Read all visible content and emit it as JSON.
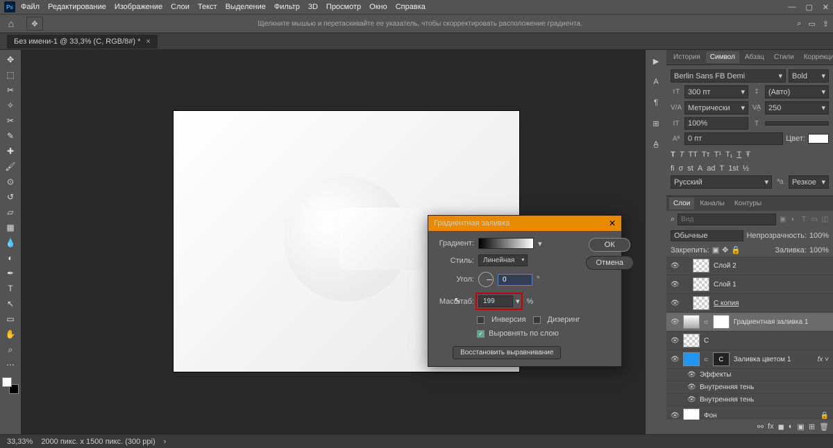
{
  "app": {
    "logo": "Ps"
  },
  "menu": [
    "Файл",
    "Редактирование",
    "Изображение",
    "Слои",
    "Текст",
    "Выделение",
    "Фильтр",
    "3D",
    "Просмотр",
    "Окно",
    "Справка"
  ],
  "optbar_hint": "Щелкните мышью и перетаскивайте ее указатель, чтобы скорректировать расположение градиента.",
  "doc_tab": "Без имени-1 @ 33,3% (C, RGB/8#) *",
  "panels_top": {
    "tabs": [
      "История",
      "Символ",
      "Абзац",
      "Стили",
      "Коррекция"
    ],
    "active": 1
  },
  "char": {
    "font": "Berlin Sans FB Demi",
    "style": "Bold",
    "size": "300 пт",
    "leading": "(Авто)",
    "kerning": "Метрически",
    "tracking": "250",
    "vscale": "100%",
    "hscale": "",
    "baseline": "0 пт",
    "color_label": "Цвет:",
    "lang": "Русский",
    "aa": "Резкое"
  },
  "layers_tabs": {
    "tabs": [
      "Слои",
      "Каналы",
      "Контуры"
    ],
    "active": 0
  },
  "layers_panel": {
    "filter_placeholder": "Вид",
    "blend": "Обычные",
    "op_label": "Непрозрачность:",
    "op": "100%",
    "lock_label": "Закрепить:",
    "fill_label": "Заливка:",
    "fill": "100%"
  },
  "layers": [
    {
      "name": "Слой 2",
      "thumb": "checker"
    },
    {
      "name": "Слой 1",
      "thumb": "checker"
    },
    {
      "name": "С копия",
      "thumb": "checker",
      "u": true
    },
    {
      "name": "Градиентная заливка 1",
      "thumb": "grad",
      "sel": true,
      "mask": true
    },
    {
      "name": "С",
      "thumb": "checker"
    },
    {
      "name": "Заливка цветом 1",
      "thumb": "blue",
      "mask": true,
      "maskC": true,
      "fx": true
    },
    {
      "name": "Фон",
      "thumb": "white",
      "lock": true
    }
  ],
  "effects": {
    "label": "Эффекты",
    "items": [
      "Внутренняя тень",
      "Внутренняя тень"
    ]
  },
  "dialog": {
    "title": "Градиентная заливка",
    "gradient_label": "Градиент:",
    "style_label": "Стиль:",
    "style_val": "Линейная",
    "angle_label": "Угол:",
    "angle_val": "0",
    "angle_deg": "°",
    "scale_label": "Масштаб:",
    "scale_val": "199",
    "pct": "%",
    "invert": "Инверсия",
    "dither": "Дизеринг",
    "align": "Выровнять по слою",
    "restore": "Восстановить выравнивание",
    "ok": "ОК",
    "cancel": "Отмена"
  },
  "status": {
    "zoom": "33,33%",
    "info": "2000 пикс. x 1500 пикс. (300 ppi)"
  }
}
